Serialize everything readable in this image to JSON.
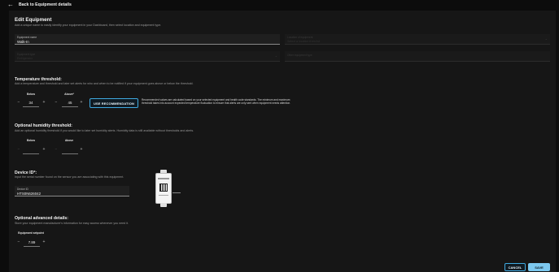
{
  "topbar": {
    "back_label": "Back to Equipment details"
  },
  "page": {
    "title": "Edit Equipment",
    "description": "Add a unique name to easily identify your equipment in your Dashboard, then select location and equipment type."
  },
  "fields": {
    "equipment_name": {
      "label": "Equipment name",
      "value": "Walk-In"
    },
    "location": {
      "label": "Location of equipment",
      "value": "Select a location from list"
    },
    "equipment_type": {
      "label": "Equipment type",
      "value": "Refrigerator"
    },
    "other_type": {
      "label": "Other equipment type",
      "value": ""
    }
  },
  "temperature": {
    "title": "Temperature threshold:",
    "description": "Add a temperature and threshold and later set alerts for who and when to be notified if your equipment goes above or below the threshold.",
    "below_label": "Below",
    "below_value": "34",
    "above_label": "Above*",
    "above_value": "45",
    "recommendation_button": "USE RECOMMENDATION",
    "recommendation_note": "Recommended values are calculated based on your selected equipment and health code standards. The minimum and maximum threshold takes into account expected temperature fluctuation to ensure that alerts are only sent when equipment needs attention."
  },
  "humidity": {
    "title": "Optional humidity threshold:",
    "description": "Add an optional humidity threshold if you would like to later set humidity alerts. Humidity data is still available without thresholds and alerts.",
    "below_label": "Below",
    "below_value": "",
    "above_label": "Above",
    "above_value": ""
  },
  "device": {
    "title": "Device ID*:",
    "description": "Input the serial number found on the sensor you are associating with this equipment.",
    "field_label": "Device ID",
    "field_value": "HTS0N626042"
  },
  "advanced": {
    "title": "Optional advanced details:",
    "description": "Store your equipment manufacturer's information for easy access whenever you need it.",
    "setpoint_label": "Equipment setpoint",
    "setpoint_value": "7.89"
  },
  "footer": {
    "cancel_label": "CANCEL",
    "save_label": "SAVE"
  },
  "icons": {
    "back": "arrow-left-icon",
    "minus": "minus-icon",
    "plus": "plus-icon",
    "chevron": "chevron-down-icon"
  },
  "colors": {
    "accent": "#3fa9e0",
    "save_bg": "#7cc8ef",
    "background": "#0c0c0c",
    "panel": "#161616"
  }
}
